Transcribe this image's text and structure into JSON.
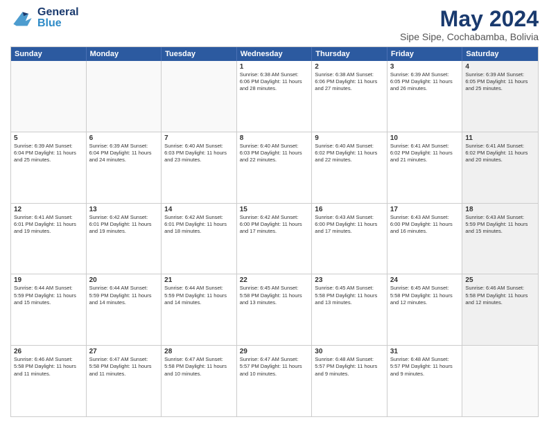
{
  "header": {
    "logo_general": "General",
    "logo_blue": "Blue",
    "title": "May 2024",
    "subtitle": "Sipe Sipe, Cochabamba, Bolivia"
  },
  "days_of_week": [
    "Sunday",
    "Monday",
    "Tuesday",
    "Wednesday",
    "Thursday",
    "Friday",
    "Saturday"
  ],
  "weeks": [
    [
      {
        "day": "",
        "info": "",
        "empty": true
      },
      {
        "day": "",
        "info": "",
        "empty": true
      },
      {
        "day": "",
        "info": "",
        "empty": true
      },
      {
        "day": "1",
        "info": "Sunrise: 6:38 AM\nSunset: 6:06 PM\nDaylight: 11 hours\nand 28 minutes.",
        "empty": false
      },
      {
        "day": "2",
        "info": "Sunrise: 6:38 AM\nSunset: 6:06 PM\nDaylight: 11 hours\nand 27 minutes.",
        "empty": false
      },
      {
        "day": "3",
        "info": "Sunrise: 6:39 AM\nSunset: 6:05 PM\nDaylight: 11 hours\nand 26 minutes.",
        "empty": false
      },
      {
        "day": "4",
        "info": "Sunrise: 6:39 AM\nSunset: 6:05 PM\nDaylight: 11 hours\nand 25 minutes.",
        "empty": false,
        "shaded": true
      }
    ],
    [
      {
        "day": "5",
        "info": "Sunrise: 6:39 AM\nSunset: 6:04 PM\nDaylight: 11 hours\nand 25 minutes.",
        "empty": false
      },
      {
        "day": "6",
        "info": "Sunrise: 6:39 AM\nSunset: 6:04 PM\nDaylight: 11 hours\nand 24 minutes.",
        "empty": false
      },
      {
        "day": "7",
        "info": "Sunrise: 6:40 AM\nSunset: 6:03 PM\nDaylight: 11 hours\nand 23 minutes.",
        "empty": false
      },
      {
        "day": "8",
        "info": "Sunrise: 6:40 AM\nSunset: 6:03 PM\nDaylight: 11 hours\nand 22 minutes.",
        "empty": false
      },
      {
        "day": "9",
        "info": "Sunrise: 6:40 AM\nSunset: 6:02 PM\nDaylight: 11 hours\nand 22 minutes.",
        "empty": false
      },
      {
        "day": "10",
        "info": "Sunrise: 6:41 AM\nSunset: 6:02 PM\nDaylight: 11 hours\nand 21 minutes.",
        "empty": false
      },
      {
        "day": "11",
        "info": "Sunrise: 6:41 AM\nSunset: 6:02 PM\nDaylight: 11 hours\nand 20 minutes.",
        "empty": false,
        "shaded": true
      }
    ],
    [
      {
        "day": "12",
        "info": "Sunrise: 6:41 AM\nSunset: 6:01 PM\nDaylight: 11 hours\nand 19 minutes.",
        "empty": false
      },
      {
        "day": "13",
        "info": "Sunrise: 6:42 AM\nSunset: 6:01 PM\nDaylight: 11 hours\nand 19 minutes.",
        "empty": false
      },
      {
        "day": "14",
        "info": "Sunrise: 6:42 AM\nSunset: 6:01 PM\nDaylight: 11 hours\nand 18 minutes.",
        "empty": false
      },
      {
        "day": "15",
        "info": "Sunrise: 6:42 AM\nSunset: 6:00 PM\nDaylight: 11 hours\nand 17 minutes.",
        "empty": false
      },
      {
        "day": "16",
        "info": "Sunrise: 6:43 AM\nSunset: 6:00 PM\nDaylight: 11 hours\nand 17 minutes.",
        "empty": false
      },
      {
        "day": "17",
        "info": "Sunrise: 6:43 AM\nSunset: 6:00 PM\nDaylight: 11 hours\nand 16 minutes.",
        "empty": false
      },
      {
        "day": "18",
        "info": "Sunrise: 6:43 AM\nSunset: 5:59 PM\nDaylight: 11 hours\nand 15 minutes.",
        "empty": false,
        "shaded": true
      }
    ],
    [
      {
        "day": "19",
        "info": "Sunrise: 6:44 AM\nSunset: 5:59 PM\nDaylight: 11 hours\nand 15 minutes.",
        "empty": false
      },
      {
        "day": "20",
        "info": "Sunrise: 6:44 AM\nSunset: 5:59 PM\nDaylight: 11 hours\nand 14 minutes.",
        "empty": false
      },
      {
        "day": "21",
        "info": "Sunrise: 6:44 AM\nSunset: 5:59 PM\nDaylight: 11 hours\nand 14 minutes.",
        "empty": false
      },
      {
        "day": "22",
        "info": "Sunrise: 6:45 AM\nSunset: 5:58 PM\nDaylight: 11 hours\nand 13 minutes.",
        "empty": false
      },
      {
        "day": "23",
        "info": "Sunrise: 6:45 AM\nSunset: 5:58 PM\nDaylight: 11 hours\nand 13 minutes.",
        "empty": false
      },
      {
        "day": "24",
        "info": "Sunrise: 6:45 AM\nSunset: 5:58 PM\nDaylight: 11 hours\nand 12 minutes.",
        "empty": false
      },
      {
        "day": "25",
        "info": "Sunrise: 6:46 AM\nSunset: 5:58 PM\nDaylight: 11 hours\nand 12 minutes.",
        "empty": false,
        "shaded": true
      }
    ],
    [
      {
        "day": "26",
        "info": "Sunrise: 6:46 AM\nSunset: 5:58 PM\nDaylight: 11 hours\nand 11 minutes.",
        "empty": false
      },
      {
        "day": "27",
        "info": "Sunrise: 6:47 AM\nSunset: 5:58 PM\nDaylight: 11 hours\nand 11 minutes.",
        "empty": false
      },
      {
        "day": "28",
        "info": "Sunrise: 6:47 AM\nSunset: 5:58 PM\nDaylight: 11 hours\nand 10 minutes.",
        "empty": false
      },
      {
        "day": "29",
        "info": "Sunrise: 6:47 AM\nSunset: 5:57 PM\nDaylight: 11 hours\nand 10 minutes.",
        "empty": false
      },
      {
        "day": "30",
        "info": "Sunrise: 6:48 AM\nSunset: 5:57 PM\nDaylight: 11 hours\nand 9 minutes.",
        "empty": false
      },
      {
        "day": "31",
        "info": "Sunrise: 6:48 AM\nSunset: 5:57 PM\nDaylight: 11 hours\nand 9 minutes.",
        "empty": false
      },
      {
        "day": "",
        "info": "",
        "empty": true,
        "shaded": true
      }
    ]
  ]
}
